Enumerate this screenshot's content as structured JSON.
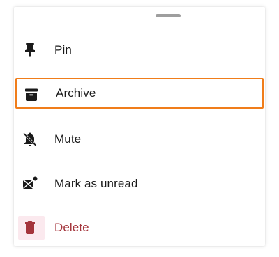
{
  "menu": {
    "items": [
      {
        "label": "Pin",
        "icon": "pin-icon"
      },
      {
        "label": "Archive",
        "icon": "archive-icon"
      },
      {
        "label": "Mute",
        "icon": "bell-off-icon"
      },
      {
        "label": "Mark as unread",
        "icon": "mark-unread-icon"
      },
      {
        "label": "Delete",
        "icon": "trash-icon"
      }
    ],
    "selected": "Archive"
  },
  "colors": {
    "focus_outline": "#f07d1a",
    "danger": "#a4343b",
    "text": "#1a1a1a",
    "handle": "#9e9e9e"
  }
}
